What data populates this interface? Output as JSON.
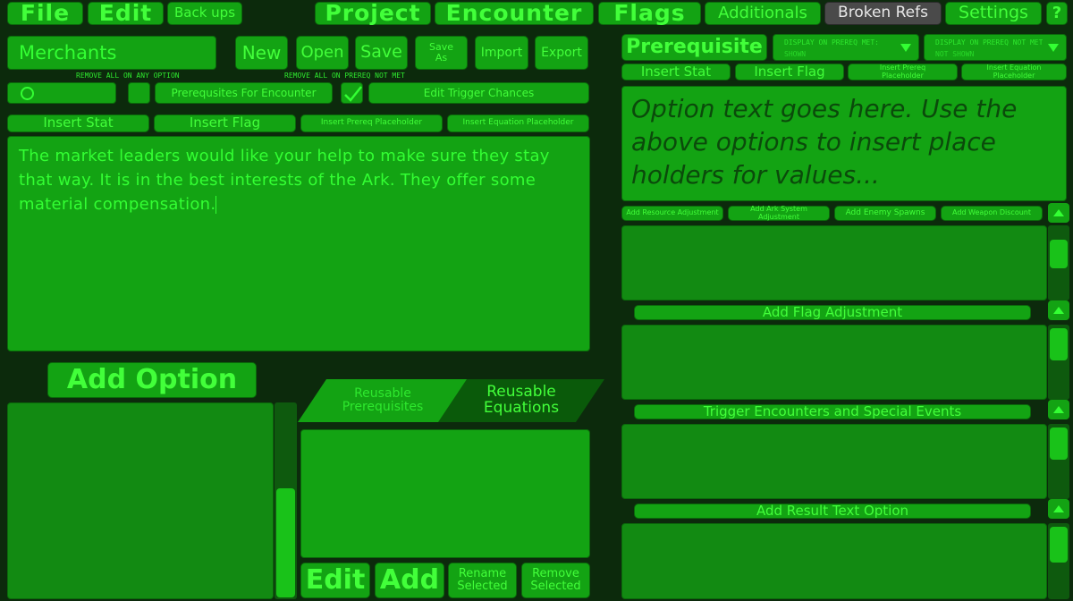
{
  "menu": {
    "file": "File",
    "edit": "Edit",
    "backups": "Back ups",
    "project": "Project",
    "encounter": "Encounter",
    "flags": "Flags",
    "additionals": "Additionals",
    "broken_refs": "Broken Refs",
    "settings": "Settings",
    "help": "?"
  },
  "encounter": {
    "name_value": "Merchants",
    "new": "New",
    "open": "Open",
    "save": "Save",
    "save_as": "Save As",
    "import": "Import",
    "export": "Export",
    "remove_all_any_option": "REMOVE ALL ON ANY OPTION",
    "remove_all_prereq_not_met": "REMOVE ALL ON PREREQ NOT MET",
    "counter_value": "0",
    "prereq_for_encounter": "Prerequsites For Encounter",
    "edit_trigger_chances": "Edit Trigger Chances",
    "insert_stat": "Insert Stat",
    "insert_flag": "Insert Flag",
    "insert_prereq_placeholder": "Insert Prereq Placeholder",
    "insert_equation_placeholder": "Insert Equation Placeholder",
    "body_text": "The market leaders would like your help to make sure they stay that way.  It is in the best interests of the Ark.  They offer some material compensation."
  },
  "options": {
    "add_option": "Add Option"
  },
  "reusable": {
    "tab_prerequisites": "Reusable Prerequisites",
    "tab_equations": "Reusable Equations",
    "edit": "Edit",
    "add": "Add",
    "rename_selected": "Rename Selected",
    "remove_selected": "Remove Selected"
  },
  "right": {
    "prerequisite": "Prerequisite",
    "display_on_met_label": "DISPLAY ON PREREQ MET:",
    "display_on_met_value": "SHOWN",
    "display_not_met_label": "DISPLAY ON PREREQ NOT MET:",
    "display_not_met_value": "NOT SHOWN",
    "insert_stat": "Insert Stat",
    "insert_flag": "Insert Flag",
    "insert_prereq_placeholder": "Insert Prereq Placeholder",
    "insert_equation_placeholder": "Insert Equation Placeholder",
    "option_text_placeholder": "Option text goes here. Use the above options to insert place holders for values...",
    "add_resource_adjustment": "Add Resource Adjustment",
    "add_ark_system_adjustment": "Add Ark System Adjustment",
    "add_enemy_spawns": "Add Enemy Spawns",
    "add_weapon_discount": "Add Weapon Discount",
    "add_flag_adjustment": "Add Flag Adjustment",
    "trigger_encounters": "Trigger Encounters and Special Events",
    "add_result_text_option": "Add Result Text Option"
  },
  "colors": {
    "background": "#0c2a0c",
    "panel": "#13a313",
    "text": "#33ff33"
  }
}
